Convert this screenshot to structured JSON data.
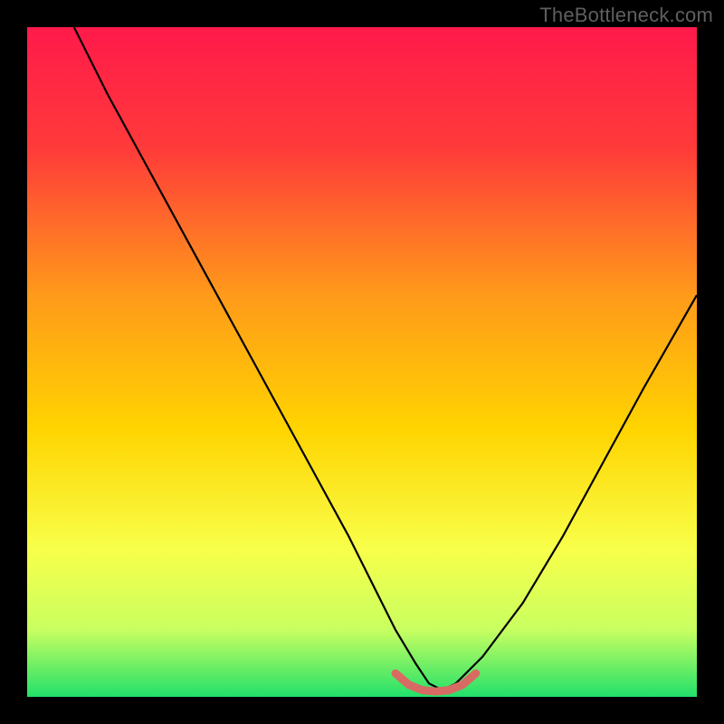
{
  "watermark": "TheBottleneck.com",
  "chart_data": {
    "type": "line",
    "title": "",
    "xlabel": "",
    "ylabel": "",
    "xlim": [
      0,
      100
    ],
    "ylim": [
      0,
      100
    ],
    "series": [
      {
        "name": "bottleneck-curve",
        "x": [
          7,
          12,
          18,
          24,
          30,
          36,
          42,
          48,
          52,
          55,
          58,
          60,
          62,
          64,
          68,
          74,
          80,
          86,
          92,
          100
        ],
        "values": [
          100,
          90,
          79,
          68,
          57,
          46,
          35,
          24,
          16,
          10,
          5,
          2,
          1,
          2,
          6,
          14,
          24,
          35,
          46,
          60
        ]
      },
      {
        "name": "sweet-spot-marker",
        "x": [
          55,
          57,
          59,
          61,
          63,
          65,
          67
        ],
        "values": [
          3.5,
          1.8,
          1.0,
          0.8,
          1.0,
          1.8,
          3.5
        ]
      }
    ],
    "gradient_stops": [
      {
        "offset": 0,
        "color": "#ff1a4b"
      },
      {
        "offset": 18,
        "color": "#ff3a3a"
      },
      {
        "offset": 40,
        "color": "#ff9a1a"
      },
      {
        "offset": 60,
        "color": "#ffd400"
      },
      {
        "offset": 78,
        "color": "#f8ff4a"
      },
      {
        "offset": 90,
        "color": "#c8ff60"
      },
      {
        "offset": 100,
        "color": "#22e06a"
      }
    ],
    "marker_color": "#d86a64"
  }
}
